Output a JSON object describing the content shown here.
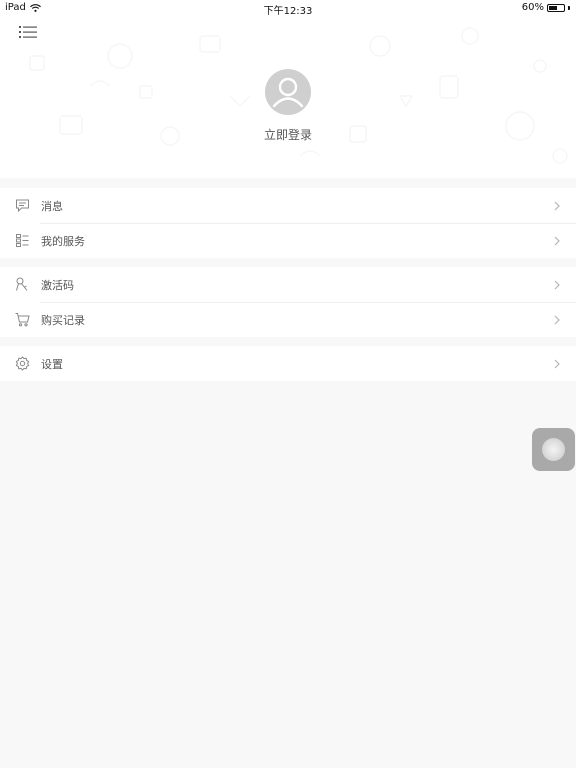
{
  "status_bar": {
    "device": "iPad",
    "time": "下午12:33",
    "battery_percent_text": "60%",
    "battery_level": 0.6,
    "wifi_icon": "wifi-icon"
  },
  "header": {
    "menu_icon": "hamburger-menu-icon",
    "avatar_icon": "default-user-avatar-icon",
    "login_label": "立即登录"
  },
  "menu_groups": [
    {
      "items": [
        {
          "icon": "message-icon",
          "label": "消息"
        },
        {
          "icon": "service-list-icon",
          "label": "我的服务"
        }
      ]
    },
    {
      "items": [
        {
          "icon": "activation-key-icon",
          "label": "激活码"
        },
        {
          "icon": "shopping-cart-icon",
          "label": "购买记录"
        }
      ]
    },
    {
      "items": [
        {
          "icon": "settings-gear-icon",
          "label": "设置"
        }
      ]
    }
  ],
  "colors": {
    "background": "#f8f8f8",
    "card": "#ffffff",
    "text": "#555555",
    "icon": "#888888",
    "chevron": "#b5b5b5",
    "avatar_bg": "#cfcfcf",
    "float_button": "#a9a9a9"
  },
  "floating_button": {
    "icon": "assistive-touch-icon"
  }
}
